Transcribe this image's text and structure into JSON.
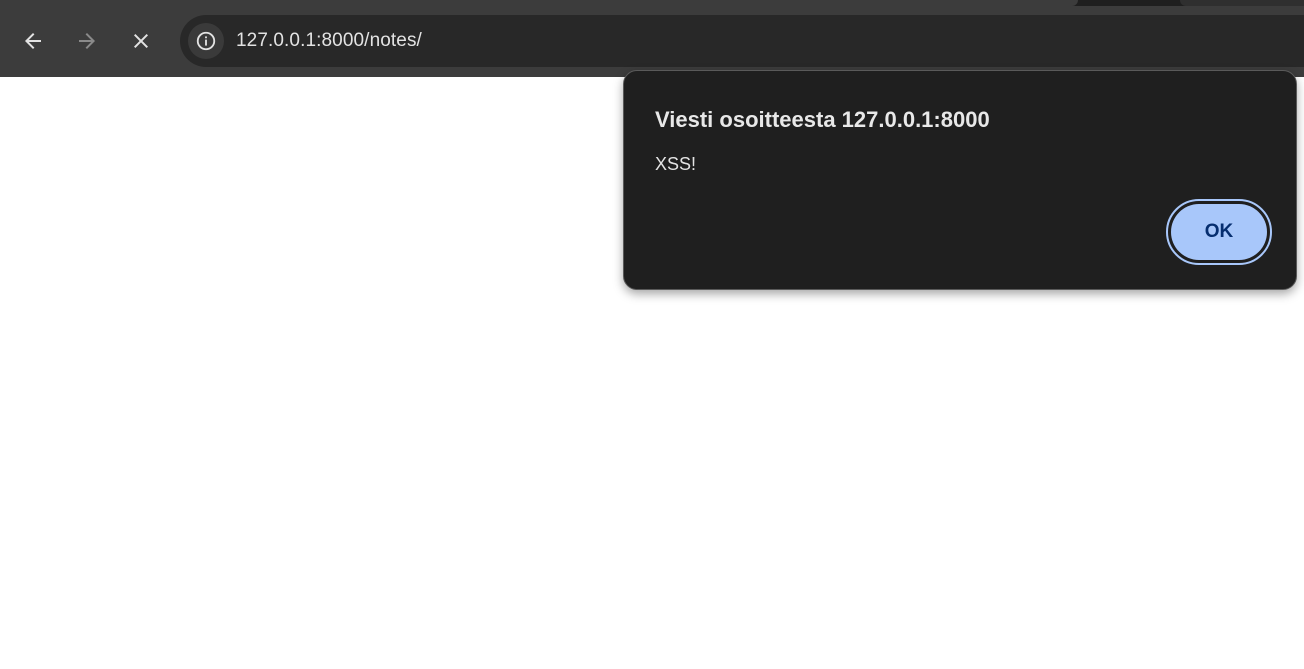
{
  "browser": {
    "address_bar": {
      "url": "127.0.0.1:8000/notes/"
    },
    "icons": {
      "back": "arrow-left-icon",
      "forward": "arrow-right-icon",
      "stop": "close-icon",
      "site_info": "info-icon"
    }
  },
  "alert": {
    "title": "Viesti osoitteesta 127.0.0.1:8000",
    "message": "XSS!",
    "ok_label": "OK"
  },
  "colors": {
    "chrome_bg": "#3c3c3c",
    "omnibox_bg": "#282828",
    "dialog_bg": "#1f1f1f",
    "accent": "#a8c7fa",
    "accent_text": "#062e6f"
  }
}
